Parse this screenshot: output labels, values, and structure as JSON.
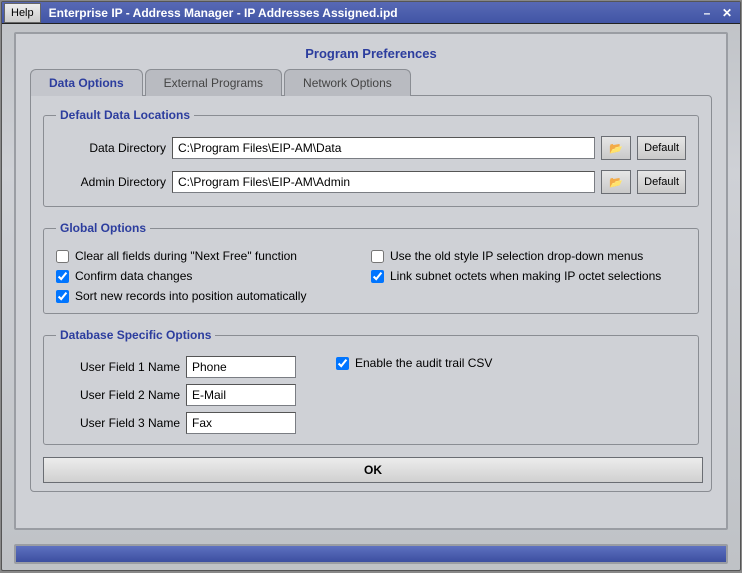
{
  "window": {
    "help_label": "Help",
    "title": "Enterprise IP - Address Manager - IP Addresses Assigned.ipd"
  },
  "heading": "Program Preferences",
  "tabs": {
    "data_options": "Data Options",
    "external_programs": "External Programs",
    "network_options": "Network Options"
  },
  "locations": {
    "legend": "Default Data Locations",
    "data_label": "Data Directory",
    "data_value": "C:\\Program Files\\EIP-AM\\Data",
    "admin_label": "Admin Directory",
    "admin_value": "C:\\Program Files\\EIP-AM\\Admin",
    "default_btn": "Default"
  },
  "global": {
    "legend": "Global Options",
    "clear_fields": "Clear all fields during \"Next Free\" function",
    "confirm_changes": "Confirm data changes",
    "sort_new": "Sort new records into position automatically",
    "old_style": "Use the old style IP selection drop-down menus",
    "link_octets": "Link subnet octets when making IP octet selections",
    "checked": {
      "clear": false,
      "confirm": true,
      "sort": true,
      "old": false,
      "link": true
    }
  },
  "db": {
    "legend": "Database Specific Options",
    "uf1_label": "User Field 1 Name",
    "uf1_value": "Phone",
    "uf2_label": "User Field 2 Name",
    "uf2_value": "E-Mail",
    "uf3_label": "User Field 3 Name",
    "uf3_value": "Fax",
    "audit": "Enable the audit trail CSV",
    "audit_checked": true
  },
  "ok_label": "OK"
}
